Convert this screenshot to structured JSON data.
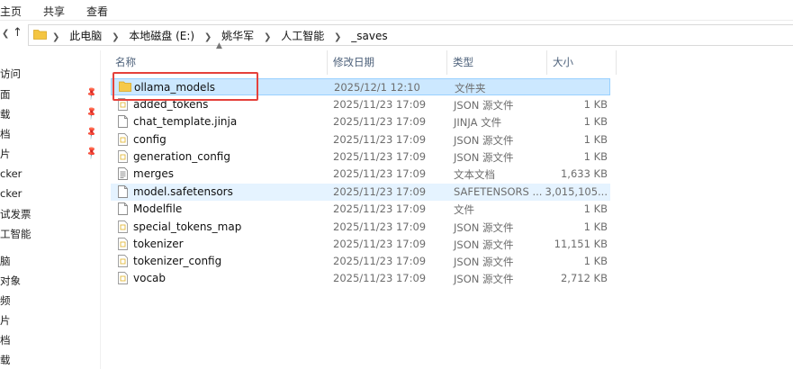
{
  "ribbon": {
    "tabs": [
      "主页",
      "共享",
      "查看"
    ]
  },
  "nav_buttons": {
    "back": "←",
    "up": "↑"
  },
  "address": {
    "crumbs": [
      "此电脑",
      "本地磁盘 (E:)",
      "姚华军",
      "人工智能",
      "_saves"
    ]
  },
  "sidebar": {
    "items": [
      {
        "label": "访问",
        "pinned": false
      },
      {
        "label": "面",
        "pinned": true
      },
      {
        "label": "载",
        "pinned": true
      },
      {
        "label": "档",
        "pinned": true
      },
      {
        "label": "片",
        "pinned": true
      },
      {
        "label": "cker",
        "pinned": false
      },
      {
        "label": "cker",
        "pinned": false
      },
      {
        "label": "试发票",
        "pinned": false
      },
      {
        "label": "工智能",
        "pinned": false
      },
      {
        "label": "脑",
        "pinned": false
      },
      {
        "label": "对象",
        "pinned": false
      },
      {
        "label": "频",
        "pinned": false
      },
      {
        "label": "片",
        "pinned": false
      },
      {
        "label": "档",
        "pinned": false
      },
      {
        "label": "载",
        "pinned": false
      }
    ]
  },
  "columns": {
    "name": "名称",
    "date": "修改日期",
    "type": "类型",
    "size": "大小"
  },
  "files": [
    {
      "name": "ollama_models",
      "date": "2025/12/1 12:10",
      "type": "文件夹",
      "size": "",
      "icon": "folder-icon",
      "state": "selected"
    },
    {
      "name": "added_tokens",
      "date": "2025/11/23 17:09",
      "type": "JSON 源文件",
      "size": "1 KB",
      "icon": "json-file-icon",
      "state": ""
    },
    {
      "name": "chat_template.jinja",
      "date": "2025/11/23 17:09",
      "type": "JINJA 文件",
      "size": "1 KB",
      "icon": "file-icon",
      "state": ""
    },
    {
      "name": "config",
      "date": "2025/11/23 17:09",
      "type": "JSON 源文件",
      "size": "1 KB",
      "icon": "json-file-icon",
      "state": ""
    },
    {
      "name": "generation_config",
      "date": "2025/11/23 17:09",
      "type": "JSON 源文件",
      "size": "1 KB",
      "icon": "json-file-icon",
      "state": ""
    },
    {
      "name": "merges",
      "date": "2025/11/23 17:09",
      "type": "文本文档",
      "size": "1,633 KB",
      "icon": "text-file-icon",
      "state": ""
    },
    {
      "name": "model.safetensors",
      "date": "2025/11/23 17:09",
      "type": "SAFETENSORS ...",
      "size": "3,015,105...",
      "icon": "file-icon",
      "state": "hover"
    },
    {
      "name": "Modelfile",
      "date": "2025/11/23 17:09",
      "type": "文件",
      "size": "1 KB",
      "icon": "file-icon",
      "state": ""
    },
    {
      "name": "special_tokens_map",
      "date": "2025/11/23 17:09",
      "type": "JSON 源文件",
      "size": "1 KB",
      "icon": "json-file-icon",
      "state": ""
    },
    {
      "name": "tokenizer",
      "date": "2025/11/23 17:09",
      "type": "JSON 源文件",
      "size": "11,151 KB",
      "icon": "json-file-icon",
      "state": ""
    },
    {
      "name": "tokenizer_config",
      "date": "2025/11/23 17:09",
      "type": "JSON 源文件",
      "size": "1 KB",
      "icon": "json-file-icon",
      "state": ""
    },
    {
      "name": "vocab",
      "date": "2025/11/23 17:09",
      "type": "JSON 源文件",
      "size": "2,712 KB",
      "icon": "json-file-icon",
      "state": ""
    }
  ],
  "colors": {
    "selection_bg": "#cce8ff",
    "selection_border": "#99d1ff",
    "hover_bg": "#e5f3ff",
    "annotation_box": "#e5413b",
    "header_text": "#4c607a"
  }
}
